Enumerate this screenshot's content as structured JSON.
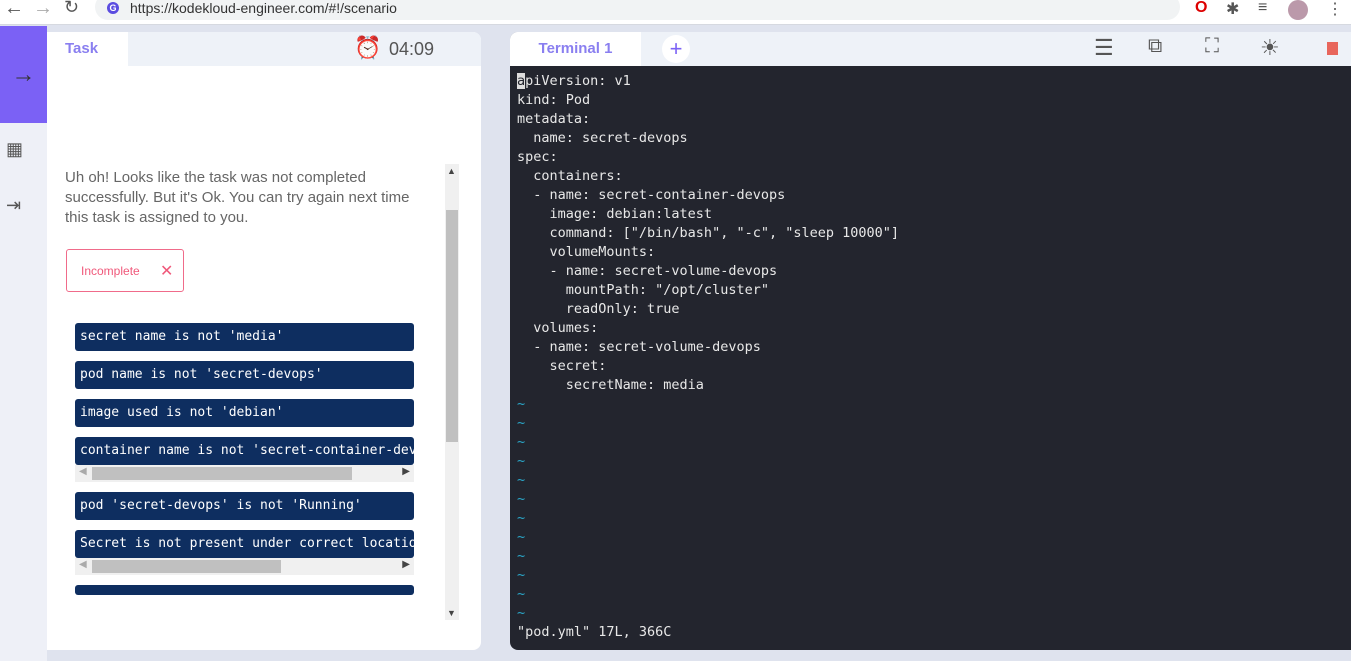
{
  "browser": {
    "url": "https://kodekloud-engineer.com/#!/scenario"
  },
  "task": {
    "tab": "Task",
    "timer": "04:09",
    "message": "Uh oh! Looks like the task was not completed successfully. But it's Ok. You can try again next time this task is assigned to you.",
    "status": "Incomplete",
    "checks": [
      "secret name is not 'media'",
      "pod name is not 'secret-devops'",
      "image used is not 'debian'",
      "container name is not 'secret-container-devops'",
      "pod 'secret-devops' is not 'Running'",
      "Secret is not present under correct location"
    ]
  },
  "terminal": {
    "tab": "Terminal 1",
    "cursor_char": "a",
    "lines": [
      "piVersion: v1",
      "kind: Pod",
      "metadata:",
      "  name: secret-devops",
      "spec:",
      "  containers:",
      "  - name: secret-container-devops",
      "    image: debian:latest",
      "    command: [\"/bin/bash\", \"-c\", \"sleep 10000\"]",
      "    volumeMounts:",
      "    - name: secret-volume-devops",
      "      mountPath: \"/opt/cluster\"",
      "      readOnly: true",
      "  volumes:",
      "  - name: secret-volume-devops",
      "    secret:",
      "      secretName: media"
    ],
    "tilde": "~",
    "status": "\"pod.yml\" 17L, 366C"
  }
}
